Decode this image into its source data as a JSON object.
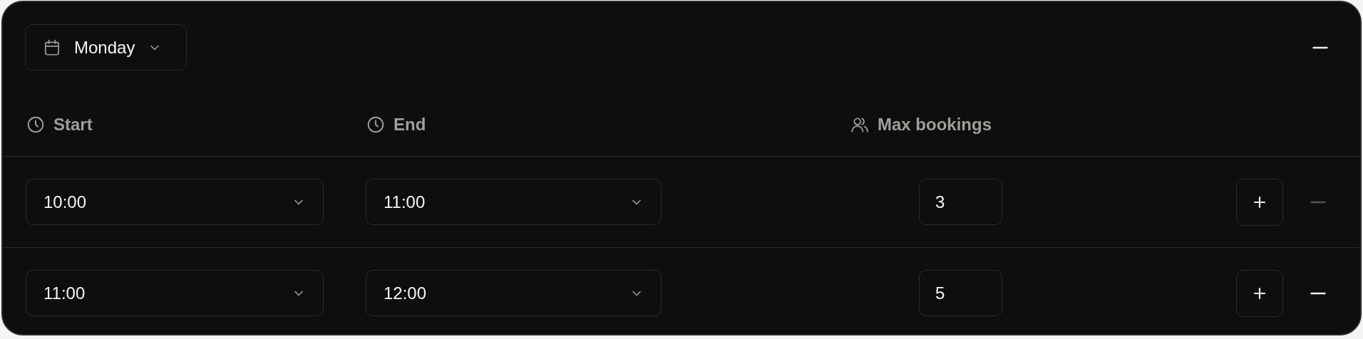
{
  "day_picker": {
    "label": "Monday"
  },
  "columns": [
    {
      "label": "Start",
      "kind": "clock"
    },
    {
      "label": "End",
      "kind": "clock"
    },
    {
      "label": "Max bookings",
      "kind": "people"
    }
  ],
  "rows": [
    {
      "start": "10:00",
      "end": "11:00",
      "max_bookings": "3",
      "remove_disabled": true
    },
    {
      "start": "11:00",
      "end": "12:00",
      "max_bookings": "5",
      "remove_disabled": false
    }
  ]
}
